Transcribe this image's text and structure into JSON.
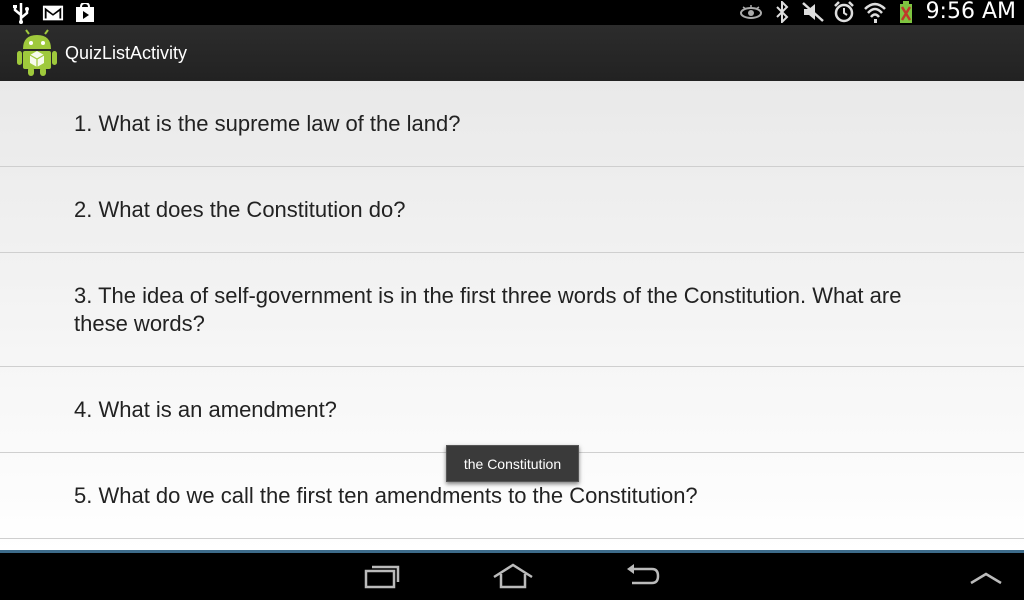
{
  "status_bar": {
    "time": "9:56 AM",
    "icons": [
      "usb-icon",
      "gmail-icon",
      "play-store-icon",
      "eye-icon",
      "bluetooth-icon",
      "mute-icon",
      "alarm-icon",
      "wifi-icon",
      "battery-icon"
    ]
  },
  "action_bar": {
    "title": "QuizListActivity",
    "app_icon": "android-icon"
  },
  "quiz_list": {
    "items": [
      {
        "label": "1. What is the supreme law of the land?"
      },
      {
        "label": "2. What does the Constitution do?"
      },
      {
        "label": "3. The idea of self-government is in the first three words of the Constitution. What are these words?"
      },
      {
        "label": "4. What is an amendment?"
      },
      {
        "label": "5. What do we call the first ten amendments to the Constitution?"
      }
    ]
  },
  "toast": {
    "text": "the Constitution"
  },
  "nav_bar": {
    "buttons": [
      "recent-apps-icon",
      "home-icon",
      "back-icon",
      "menu-up-icon"
    ]
  }
}
